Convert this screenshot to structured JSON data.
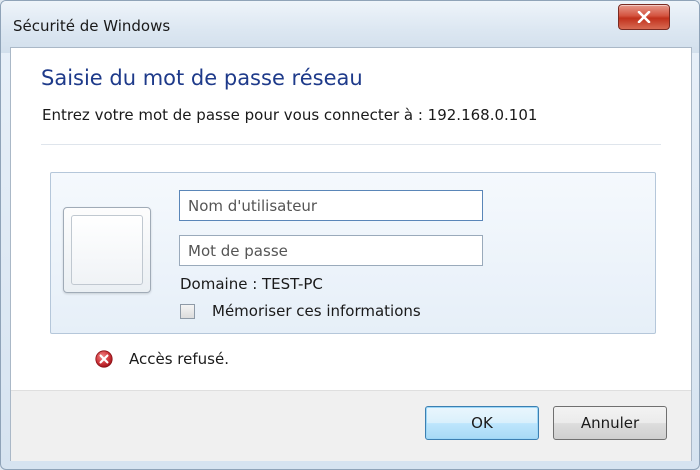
{
  "window": {
    "title": "Sécurité de Windows"
  },
  "dialog": {
    "heading": "Saisie du mot de passe réseau",
    "subtext": "Entrez votre mot de passe pour vous connecter à : 192.168.0.101"
  },
  "credentials": {
    "username_placeholder": "Nom d'utilisateur",
    "username_value": "",
    "password_placeholder": "Mot de passe",
    "password_value": "",
    "domain_label": "Domaine : TEST-PC",
    "remember_label": "Mémoriser ces informations",
    "remember_checked": false
  },
  "error": {
    "icon": "error-icon",
    "message": "Accès refusé."
  },
  "buttons": {
    "ok_label": "OK",
    "cancel_label": "Annuler"
  },
  "colors": {
    "heading": "#1e3a8a",
    "close_button": "#c1311c",
    "error_icon": "#c0292f",
    "ok_border": "#3c7fb1"
  }
}
